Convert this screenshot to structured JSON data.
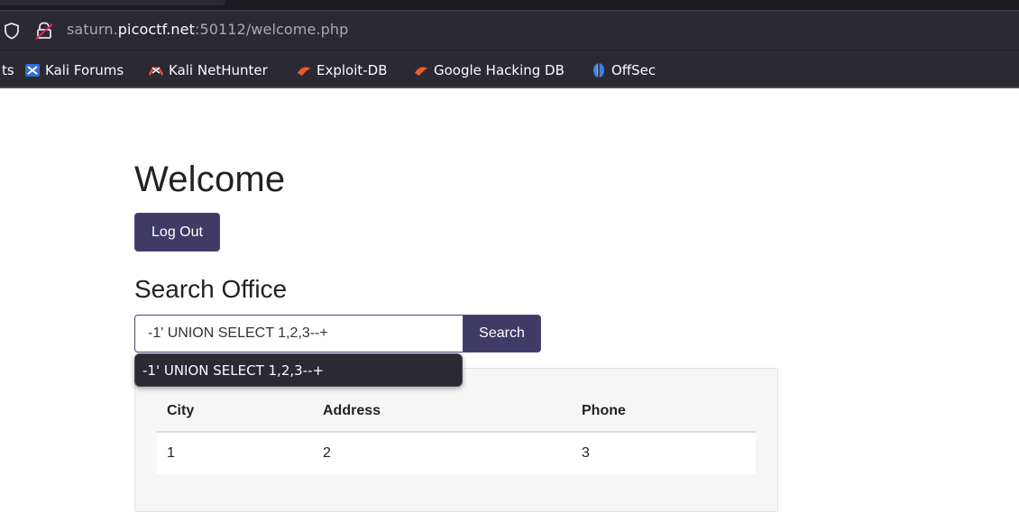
{
  "browser": {
    "url_prefix": "saturn.",
    "url_host": "picoctf.net",
    "url_rest": ":50112/welcome.php",
    "bookmarks": [
      {
        "label": "ts",
        "icon": "truncated"
      },
      {
        "label": "Kali Forums",
        "icon": "kali-forums-icon"
      },
      {
        "label": "Kali NetHunter",
        "icon": "kali-nethunter-icon"
      },
      {
        "label": "Exploit-DB",
        "icon": "exploit-db-icon"
      },
      {
        "label": "Google Hacking DB",
        "icon": "google-hacking-db-icon"
      },
      {
        "label": "OffSec",
        "icon": "offsec-icon"
      }
    ]
  },
  "page": {
    "title": "Welcome",
    "logout_label": "Log Out",
    "search_title": "Search Office",
    "search_value": "-1' UNION SELECT 1,2,3--+",
    "search_button": "Search",
    "autocomplete_suggestion": "-1' UNION SELECT 1,2,3--+",
    "table": {
      "headers": [
        "City",
        "Address",
        "Phone"
      ],
      "rows": [
        [
          "1",
          "2",
          "3"
        ]
      ]
    }
  },
  "colors": {
    "button": "#3f3a66",
    "chrome": "#2b2a33",
    "panel": "#f6f6f6"
  }
}
